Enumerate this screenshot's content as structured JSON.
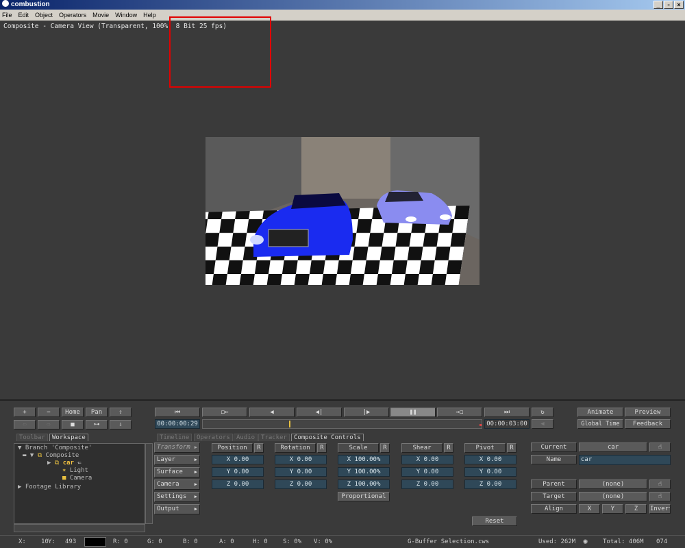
{
  "app": {
    "title": "combustion"
  },
  "menu": [
    "File",
    "Edit",
    "Object",
    "Operators",
    "Movie",
    "Window",
    "Help"
  ],
  "viewer": {
    "label": "Composite - Camera View (Transparent, 100%, 8 Bit 25 fps)"
  },
  "nav": {
    "plus": "+",
    "minus": "−",
    "home": "Home",
    "pan": "Pan"
  },
  "transport": {
    "current_time": "00:00:00:29",
    "end_time": "00:00:03:00",
    "progress": 0.31
  },
  "right_buttons": {
    "animate": "Animate",
    "preview": "Preview",
    "global_time": "Global Time",
    "feedback": "Feedback"
  },
  "left_tabs": [
    "Toolbar",
    "Workspace"
  ],
  "bottom_tabs": [
    "Timeline",
    "Operators",
    "Audio",
    "Tracker",
    "Composite Controls"
  ],
  "tree": {
    "branch": "Branch 'Composite'",
    "composite": "Composite",
    "car": "car",
    "light": "Light",
    "camera": "Camera",
    "footage": "Footage Library"
  },
  "side_menu": [
    "Transform",
    "Layer",
    "Surface",
    "Camera",
    "Settings",
    "Output"
  ],
  "transform": {
    "headers": [
      "Position",
      "Rotation",
      "Scale",
      "Shear",
      "Pivot"
    ],
    "reset_letter": "R",
    "position": [
      "X  0.00",
      "Y  0.00",
      "Z  0.00"
    ],
    "rotation": [
      "X  0.00",
      "Y  0.00",
      "Z  0.00"
    ],
    "scale": [
      "X 100.00%",
      "Y 100.00%",
      "Z 100.00%"
    ],
    "shear": [
      "X  0.00",
      "Y  0.00",
      "Z  0.00"
    ],
    "pivot": [
      "X  0.00",
      "Y  0.00",
      "Z  0.00"
    ],
    "proportional": "Proportional",
    "reset": "Reset"
  },
  "object": {
    "current_label": "Current",
    "current_value": "car",
    "name_label": "Name",
    "name_value": "car",
    "parent_label": "Parent",
    "parent_value": "(none)",
    "target_label": "Target",
    "target_value": "(none)",
    "align_label": "Align",
    "align_x": "X",
    "align_y": "Y",
    "align_z": "Z",
    "invert": "Invert"
  },
  "status": {
    "x": "X:",
    "x_val": "10",
    "y": "Y:",
    "y_val": "493",
    "r": "R:  0",
    "g": "G:  0",
    "b": "B:  0",
    "a": "A:  0",
    "h": "H:  0",
    "s": "S:  0%",
    "v": "V:  0%",
    "file": "G-Buffer Selection.cws",
    "used": "Used: 262M",
    "total": "Total: 406M",
    "frame": "074"
  }
}
